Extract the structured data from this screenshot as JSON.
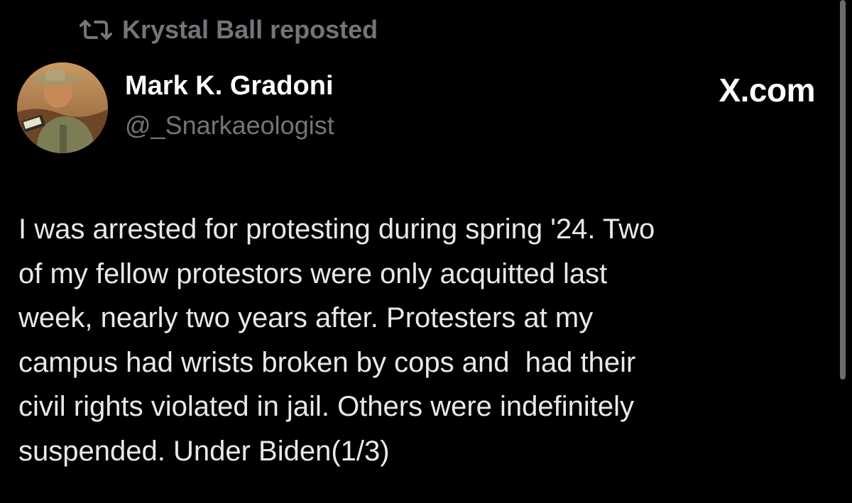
{
  "repost": {
    "icon": "repost-icon",
    "label": "Krystal Ball reposted"
  },
  "author": {
    "avatar": "avatar-photo",
    "name": "Mark K. Gradoni",
    "handle": "@_Snarkaeologist"
  },
  "brand": {
    "label": "X.com"
  },
  "tweet": {
    "lines": [
      "I was arrested for protesting during spring '24. Two",
      "of my fellow protestors were only acquitted last",
      "week, nearly two years after. Protesters at my",
      "campus had wrists broken by cops and  had their",
      "civil rights violated in jail. Others were indefinitely",
      "suspended. Under Biden(1/3)"
    ]
  },
  "colors": {
    "background": "#000000",
    "text_primary": "#e7e9ea",
    "text_secondary": "#71767b",
    "scrollbar": "#6b6b6b"
  }
}
